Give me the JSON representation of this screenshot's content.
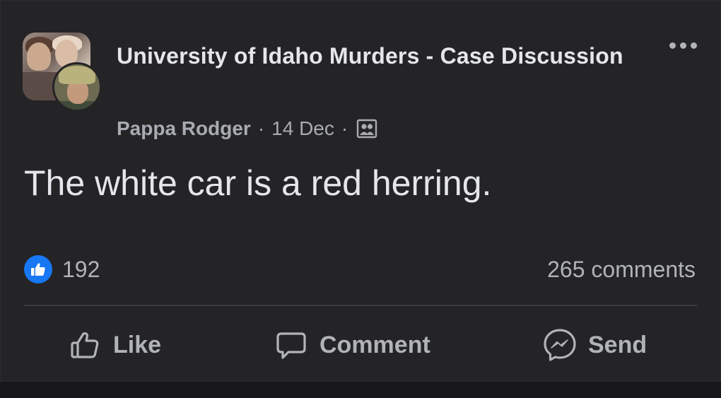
{
  "post": {
    "group_name": "University of Idaho Murders - Case Discussion",
    "author": "Pappa Rodger",
    "separator": "·",
    "date": "14 Dec",
    "audience_icon": "group-members-icon",
    "text": "The white car is a red herring.",
    "reaction_count": "192",
    "comments_count": "265 comments"
  },
  "actions": {
    "like_label": "Like",
    "comment_label": "Comment",
    "send_label": "Send"
  },
  "icons": {
    "more": "more-options-icon",
    "like_reaction": "thumbs-up-icon",
    "like": "thumbs-up-outline-icon",
    "comment": "speech-bubble-icon",
    "send": "messenger-icon"
  },
  "colors": {
    "background": "#242426",
    "primary_text": "#e4e6eb",
    "secondary_text": "#b0b3b8",
    "like_blue": "#1877f2",
    "divider": "#3a3b3c"
  }
}
